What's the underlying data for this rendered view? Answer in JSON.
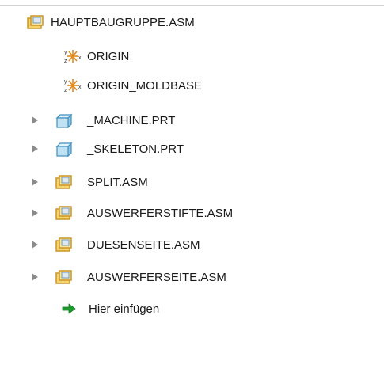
{
  "tree": {
    "root": {
      "label": "HAUPTBAUGRUPPE.ASM",
      "icon": "assembly-icon"
    },
    "items": [
      {
        "label": "ORIGIN",
        "icon": "coordinate-system-icon",
        "expandable": false
      },
      {
        "label": "ORIGIN_MOLDBASE",
        "icon": "coordinate-system-icon",
        "expandable": false
      },
      {
        "label": "_MACHINE.PRT",
        "icon": "part-icon",
        "expandable": true
      },
      {
        "label": "_SKELETON.PRT",
        "icon": "part-icon",
        "expandable": true
      },
      {
        "label": "SPLIT.ASM",
        "icon": "assembly-icon",
        "expandable": true
      },
      {
        "label": "AUSWERFERSTIFTE.ASM",
        "icon": "assembly-icon",
        "expandable": true
      },
      {
        "label": "DUESENSEITE.ASM",
        "icon": "assembly-icon",
        "expandable": true
      },
      {
        "label": "AUSWERFERSEITE.ASM",
        "icon": "assembly-icon",
        "expandable": true
      },
      {
        "label": "Hier einfügen",
        "icon": "insert-here-arrow-icon",
        "expandable": false
      }
    ]
  },
  "colors": {
    "assembly_fill": "#f7d36a",
    "assembly_stroke": "#c9962a",
    "part_fill": "#bfe3f5",
    "part_stroke": "#3f8fbf",
    "insert_arrow": "#1f9a2e",
    "expand_arrow": "#8a8a8a"
  }
}
